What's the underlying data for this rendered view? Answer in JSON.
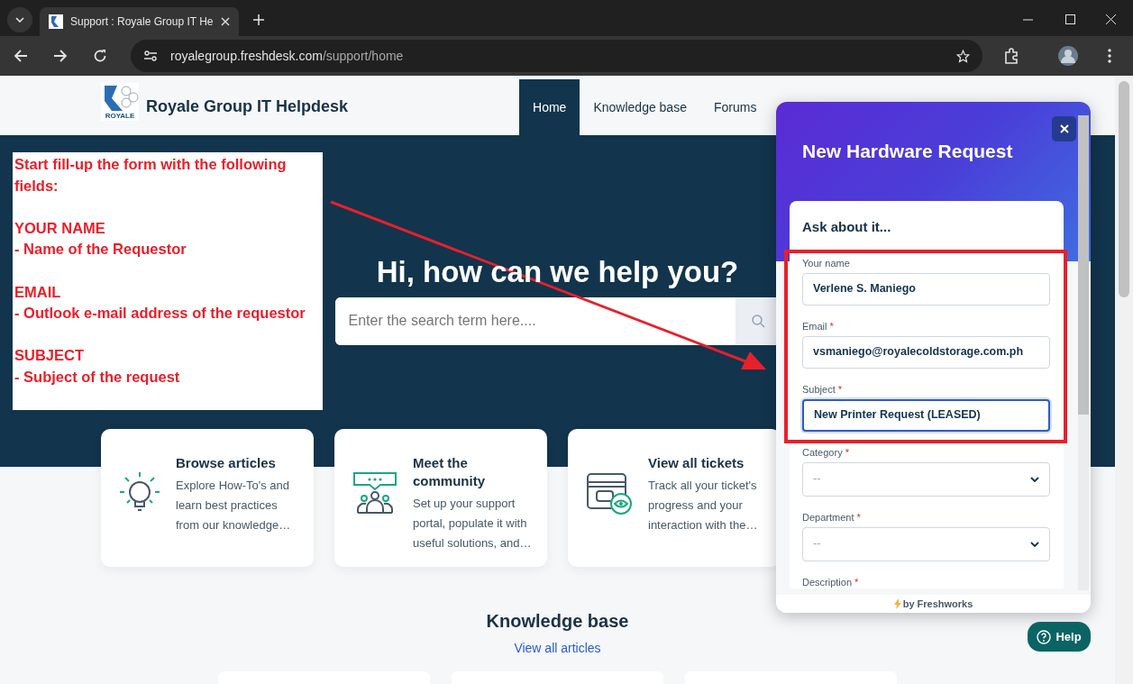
{
  "browser": {
    "tab_title": "Support : Royale Group IT He",
    "url_host": "royalegroup.freshdesk.com",
    "url_path": "/support/home"
  },
  "header": {
    "logo_text": "ROYALE",
    "brand": "Royale Group IT Helpdesk",
    "nav": [
      {
        "label": "Home",
        "selected": true
      },
      {
        "label": "Knowledge base",
        "selected": false
      },
      {
        "label": "Forums",
        "selected": false
      }
    ]
  },
  "hero": {
    "title": "Hi, how can we help you?",
    "search": {
      "placeholder": "Enter the search term here...."
    }
  },
  "cards": [
    {
      "kind": "bulb",
      "title": "Browse articles",
      "text": "Explore How-To's and learn best practices from our knowledge…"
    },
    {
      "kind": "community",
      "title": "Meet the community",
      "text": "Set up your support portal, populate it with useful solutions, and…"
    },
    {
      "kind": "tickets",
      "title": "View all tickets",
      "text": "Track all your ticket's progress and your interaction with the…"
    }
  ],
  "knowledge_base": {
    "title": "Knowledge base",
    "link": "View all articles"
  },
  "annotation": {
    "intro": "Start fill-up the form with the following fields:",
    "items": [
      {
        "field": "YOUR NAME",
        "note": "- Name of the Requestor"
      },
      {
        "field": "EMAIL",
        "note": "- Outlook e-mail address of the requestor"
      },
      {
        "field": "SUBJECT",
        "note": "- Subject of the request"
      }
    ]
  },
  "widget": {
    "title": "New Hardware Request",
    "form_title": "Ask about it...",
    "fields": [
      {
        "kind": "text",
        "label": "Your name",
        "value": "Verlene S. Maniego",
        "focused": false
      },
      {
        "kind": "text",
        "label": "Email",
        "required_mark": "*",
        "value": "vsmaniego@royalecoldstorage.com.ph",
        "focused": false
      },
      {
        "kind": "text",
        "label": "Subject",
        "required_mark": "*",
        "value": "New Printer Request (LEASED)",
        "focused": true
      },
      {
        "kind": "select",
        "label": "Category",
        "required_mark": "*",
        "value": "--",
        "focused": false
      },
      {
        "kind": "select",
        "label": "Department",
        "required_mark": "*",
        "value": "--",
        "focused": false
      },
      {
        "kind": "textarea",
        "label": "Description",
        "required_mark": "*"
      }
    ],
    "footer": "by Freshworks"
  },
  "help_button": {
    "label": "Help"
  }
}
